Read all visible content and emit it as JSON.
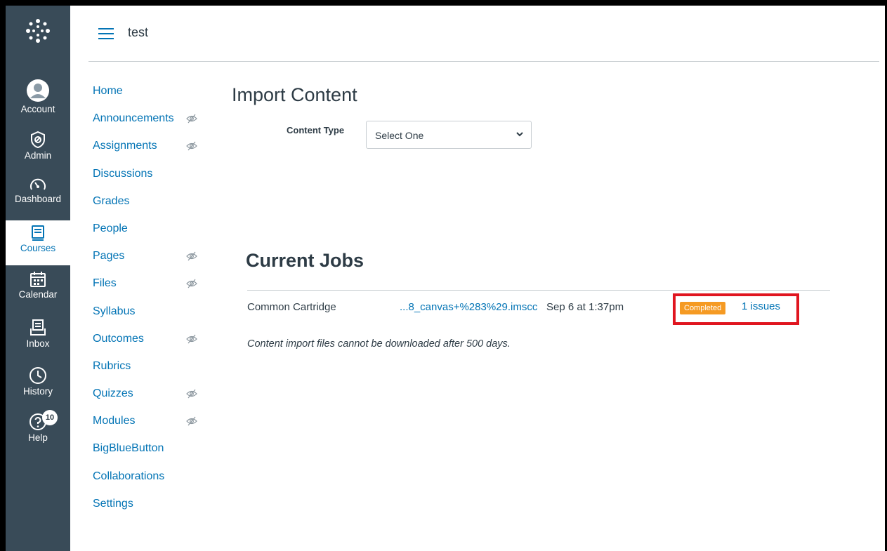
{
  "global_nav": {
    "logo_icon": "canvas-logo-icon",
    "items": [
      {
        "label": "Account",
        "icon": "account-avatar-icon"
      },
      {
        "label": "Admin",
        "icon": "admin-shield-icon"
      },
      {
        "label": "Dashboard",
        "icon": "dashboard-gauge-icon"
      },
      {
        "label": "Courses",
        "icon": "courses-book-icon",
        "active": true
      },
      {
        "label": "Calendar",
        "icon": "calendar-icon"
      },
      {
        "label": "Inbox",
        "icon": "inbox-icon"
      },
      {
        "label": "History",
        "icon": "history-clock-icon"
      },
      {
        "label": "Help",
        "icon": "help-icon",
        "badge": "10"
      }
    ]
  },
  "header": {
    "breadcrumb": "test",
    "menu_icon": "hamburger-icon"
  },
  "course_nav": [
    {
      "label": "Home",
      "hidden": false
    },
    {
      "label": "Announcements",
      "hidden": true
    },
    {
      "label": "Assignments",
      "hidden": true
    },
    {
      "label": "Discussions",
      "hidden": false
    },
    {
      "label": "Grades",
      "hidden": false
    },
    {
      "label": "People",
      "hidden": false
    },
    {
      "label": "Pages",
      "hidden": true
    },
    {
      "label": "Files",
      "hidden": true
    },
    {
      "label": "Syllabus",
      "hidden": false
    },
    {
      "label": "Outcomes",
      "hidden": true
    },
    {
      "label": "Rubrics",
      "hidden": false
    },
    {
      "label": "Quizzes",
      "hidden": true
    },
    {
      "label": "Modules",
      "hidden": true
    },
    {
      "label": "BigBlueButton",
      "hidden": false
    },
    {
      "label": "Collaborations",
      "hidden": false
    },
    {
      "label": "Settings",
      "hidden": false
    }
  ],
  "import": {
    "title": "Import Content",
    "content_type_label": "Content Type",
    "content_type_value": "Select One"
  },
  "jobs": {
    "title": "Current Jobs",
    "rows": [
      {
        "type": "Common Cartridge",
        "file": "...8_canvas+%283%29.imscc",
        "date": "Sep 6 at 1:37pm",
        "status": "Completed",
        "issues": "1 issues"
      }
    ],
    "note": "Content import files cannot be downloaded after 500 days."
  },
  "colors": {
    "nav_bg": "#394b58",
    "link": "#0374b5",
    "text": "#2d3b45",
    "status_badge": "#f59a23",
    "highlight": "#e0151f"
  }
}
